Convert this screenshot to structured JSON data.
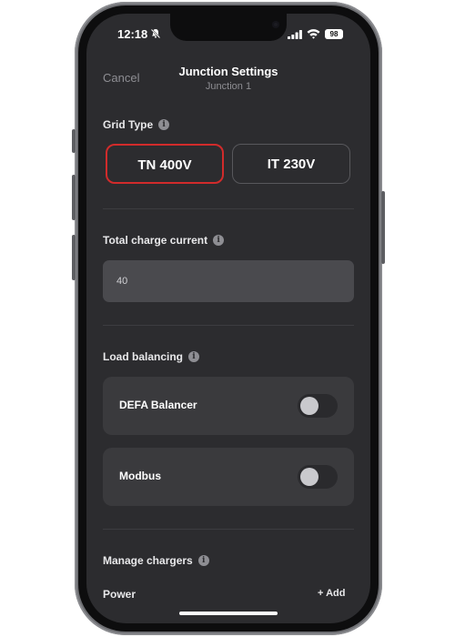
{
  "status": {
    "time": "12:18",
    "battery": "98"
  },
  "nav": {
    "cancel": "Cancel",
    "title": "Junction Settings",
    "subtitle": "Junction 1"
  },
  "grid_type": {
    "label": "Grid Type",
    "options": [
      "TN 400V",
      "IT 230V"
    ],
    "selected": "TN 400V"
  },
  "total_charge_current": {
    "label": "Total charge current",
    "value": "40"
  },
  "load_balancing": {
    "label": "Load balancing",
    "items": [
      {
        "label": "DEFA Balancer",
        "enabled": false
      },
      {
        "label": "Modbus",
        "enabled": false
      }
    ]
  },
  "manage_chargers": {
    "label": "Manage chargers",
    "power_label": "Power",
    "add_label": "+ Add"
  },
  "colors": {
    "accent": "#d12b2b",
    "background": "#2c2c2f",
    "card": "#3a3a3d"
  }
}
